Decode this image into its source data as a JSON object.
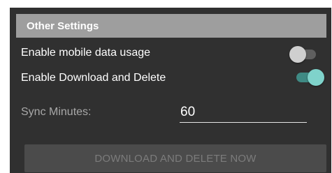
{
  "section": {
    "title": "Other Settings"
  },
  "settings": [
    {
      "label": "Enable mobile data usage",
      "enabled": false
    },
    {
      "label": "Enable Download and Delete",
      "enabled": true
    }
  ],
  "sync": {
    "label": "Sync Minutes:",
    "value": "60"
  },
  "action_button": {
    "label": "DOWNLOAD AND DELETE NOW",
    "disabled": true
  },
  "colors": {
    "panel_bg": "#303030",
    "header_bg": "#9e9e9e",
    "switch_on_thumb": "#7fd3cb",
    "switch_on_track": "#3f8a84",
    "switch_off_thumb": "#cfcfcf"
  }
}
